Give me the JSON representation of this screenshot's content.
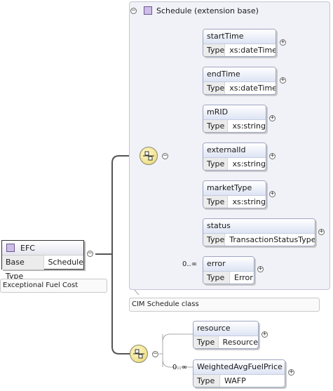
{
  "root": {
    "name": "EFC",
    "base_type_label": "Base Type",
    "base_type_value": "Schedule",
    "annotation": "Exceptional Fuel Cost"
  },
  "extension": {
    "title": "Schedule (extension base)",
    "annotation": "CIM Schedule class"
  },
  "ext_elements": [
    {
      "name": "startTime",
      "type_label": "Type",
      "type_value": "xs:dateTime"
    },
    {
      "name": "endTime",
      "type_label": "Type",
      "type_value": "xs:dateTime"
    },
    {
      "name": "mRID",
      "type_label": "Type",
      "type_value": "xs:string"
    },
    {
      "name": "externalId",
      "type_label": "Type",
      "type_value": "xs:string"
    },
    {
      "name": "marketType",
      "type_label": "Type",
      "type_value": "xs:string"
    },
    {
      "name": "status",
      "type_label": "Type",
      "type_value": "TransactionStatusType"
    },
    {
      "name": "error",
      "type_label": "Type",
      "type_value": "Error",
      "occurrence": "0..∞"
    }
  ],
  "seq_elements": [
    {
      "name": "resource",
      "type_label": "Type",
      "type_value": "Resource"
    },
    {
      "name": "WeightedAvgFuelPrice",
      "type_label": "Type",
      "type_value": "WAFP",
      "occurrence": "0..∞"
    }
  ],
  "symbols": {
    "collapse": "−",
    "expand": "+"
  },
  "icons": {
    "complex_type": "complex-type-icon",
    "sequence": "sequence-compositor-icon"
  }
}
